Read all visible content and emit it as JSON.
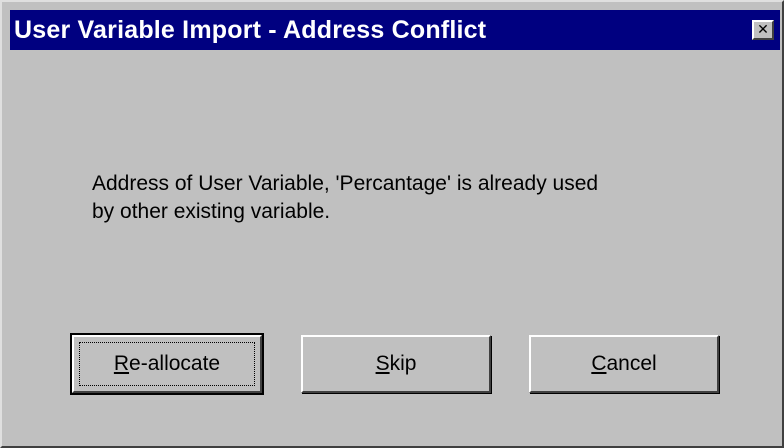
{
  "window": {
    "title": "User Variable Import - Address Conflict",
    "close_glyph": "✕"
  },
  "message": {
    "line1": "Address of User Variable, 'Percantage' is already used",
    "line2": "by other existing variable."
  },
  "buttons": {
    "reallocate": {
      "mnemonic": "R",
      "rest": "e-allocate"
    },
    "skip": {
      "mnemonic": "S",
      "rest": "kip"
    },
    "cancel": {
      "mnemonic": "C",
      "rest": "ancel"
    }
  },
  "colors": {
    "titlebar": "#000080",
    "face": "#c0c0c0",
    "title_text": "#ffffff"
  }
}
